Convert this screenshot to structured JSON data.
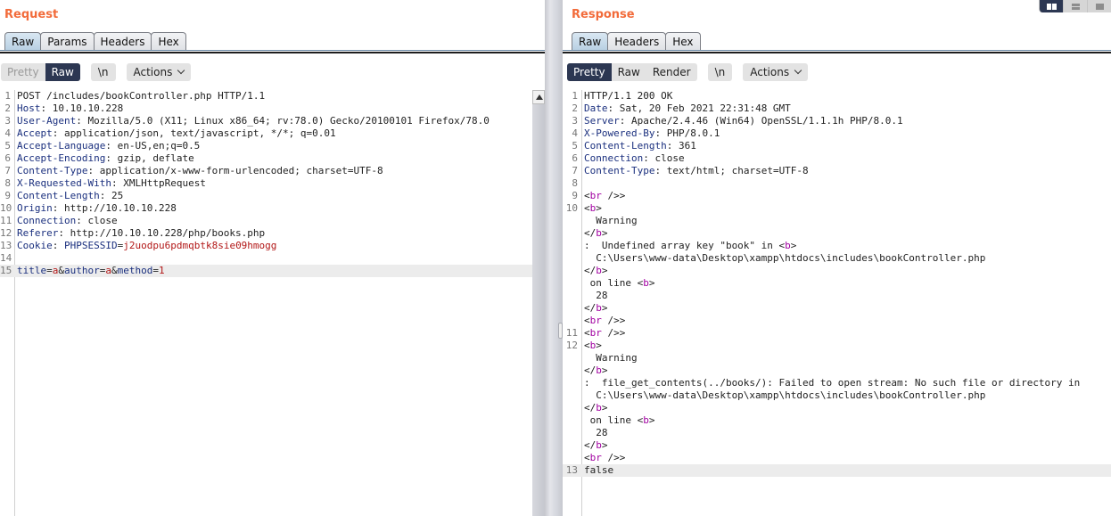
{
  "layout_buttons": [
    {
      "icon": "split-horizontal-icon",
      "active": true
    },
    {
      "icon": "split-vertical-icon",
      "active": false
    },
    {
      "icon": "single-pane-icon",
      "active": false
    }
  ],
  "request": {
    "title": "Request",
    "tabs": [
      "Raw",
      "Params",
      "Headers",
      "Hex"
    ],
    "active_tab": "Raw",
    "view_modes": [
      "Pretty",
      "Raw"
    ],
    "active_view": "Raw",
    "newline_label": "\\n",
    "actions_label": "Actions",
    "lines": [
      {
        "n": "1",
        "text": "POST /includes/bookController.php HTTP/1.1"
      },
      {
        "n": "2",
        "name": "Host",
        "value": "10.10.10.228"
      },
      {
        "n": "3",
        "name": "User-Agent",
        "value": "Mozilla/5.0 (X11; Linux x86_64; rv:78.0) Gecko/20100101 Firefox/78.0"
      },
      {
        "n": "4",
        "name": "Accept",
        "value": "application/json, text/javascript, */*; q=0.01"
      },
      {
        "n": "5",
        "name": "Accept-Language",
        "value": "en-US,en;q=0.5"
      },
      {
        "n": "6",
        "name": "Accept-Encoding",
        "value": "gzip, deflate"
      },
      {
        "n": "7",
        "name": "Content-Type",
        "value": "application/x-www-form-urlencoded; charset=UTF-8"
      },
      {
        "n": "8",
        "name": "X-Requested-With",
        "value": "XMLHttpRequest"
      },
      {
        "n": "9",
        "name": "Content-Length",
        "value": "25"
      },
      {
        "n": "10",
        "name": "Origin",
        "value": "http://10.10.10.228"
      },
      {
        "n": "11",
        "name": "Connection",
        "value": "close"
      },
      {
        "n": "12",
        "name": "Referer",
        "value": "http://10.10.10.228/php/books.php"
      },
      {
        "n": "13",
        "cookie_label": "Cookie",
        "cookie_name": "PHPSESSID",
        "cookie_value": "j2uodpu6pdmqbtk8sie09hmogg"
      },
      {
        "n": "14",
        "text": ""
      },
      {
        "n": "15",
        "params": [
          {
            "k": "title",
            "v": "a"
          },
          {
            "k": "author",
            "v": "a"
          },
          {
            "k": "method",
            "v": "1"
          }
        ]
      }
    ]
  },
  "response": {
    "title": "Response",
    "tabs": [
      "Raw",
      "Headers",
      "Hex"
    ],
    "active_tab": "Raw",
    "view_modes": [
      "Pretty",
      "Raw",
      "Render"
    ],
    "active_view": "Pretty",
    "newline_label": "\\n",
    "actions_label": "Actions",
    "lines": [
      {
        "n": "1",
        "text": "HTTP/1.1 200 OK"
      },
      {
        "n": "2",
        "name": "Date",
        "value": "Sat, 20 Feb 2021 22:31:48 GMT"
      },
      {
        "n": "3",
        "name": "Server",
        "value": "Apache/2.4.46 (Win64) OpenSSL/1.1.1h PHP/8.0.1"
      },
      {
        "n": "4",
        "name": "X-Powered-By",
        "value": "PHP/8.0.1"
      },
      {
        "n": "5",
        "name": "Content-Length",
        "value": "361"
      },
      {
        "n": "6",
        "name": "Connection",
        "value": "close"
      },
      {
        "n": "7",
        "name": "Content-Type",
        "value": "text/html; charset=UTF-8"
      },
      {
        "n": "8",
        "text": ""
      },
      {
        "n": "9",
        "tag": "br",
        "close": " />"
      },
      {
        "n": "10",
        "tag": "b"
      },
      {
        "n": "",
        "text": "  Warning"
      },
      {
        "n": "",
        "endtag": "b"
      },
      {
        "n": "",
        "text": ":  Undefined array key \"book\" in ",
        "tag_after": "b"
      },
      {
        "n": "",
        "text": "  C:\\Users\\www-data\\Desktop\\xampp\\htdocs\\includes\\bookController.php"
      },
      {
        "n": "",
        "endtag": "b"
      },
      {
        "n": "",
        "text": " on line ",
        "tag_after": "b"
      },
      {
        "n": "",
        "text": "  28"
      },
      {
        "n": "",
        "endtag": "b"
      },
      {
        "n": "",
        "tag": "br",
        "close": " />"
      },
      {
        "n": "11",
        "tag": "br",
        "close": " />"
      },
      {
        "n": "12",
        "tag": "b"
      },
      {
        "n": "",
        "text": "  Warning"
      },
      {
        "n": "",
        "endtag": "b"
      },
      {
        "n": "",
        "text": ":  file_get_contents(../books/): Failed to open stream: No such file or directory in"
      },
      {
        "n": "",
        "text": "  C:\\Users\\www-data\\Desktop\\xampp\\htdocs\\includes\\bookController.php"
      },
      {
        "n": "",
        "endtag": "b"
      },
      {
        "n": "",
        "text": " on line ",
        "tag_after": "b"
      },
      {
        "n": "",
        "text": "  28"
      },
      {
        "n": "",
        "endtag": "b"
      },
      {
        "n": "",
        "tag": "br",
        "close": " />"
      },
      {
        "n": "13",
        "text": "false"
      }
    ]
  }
}
